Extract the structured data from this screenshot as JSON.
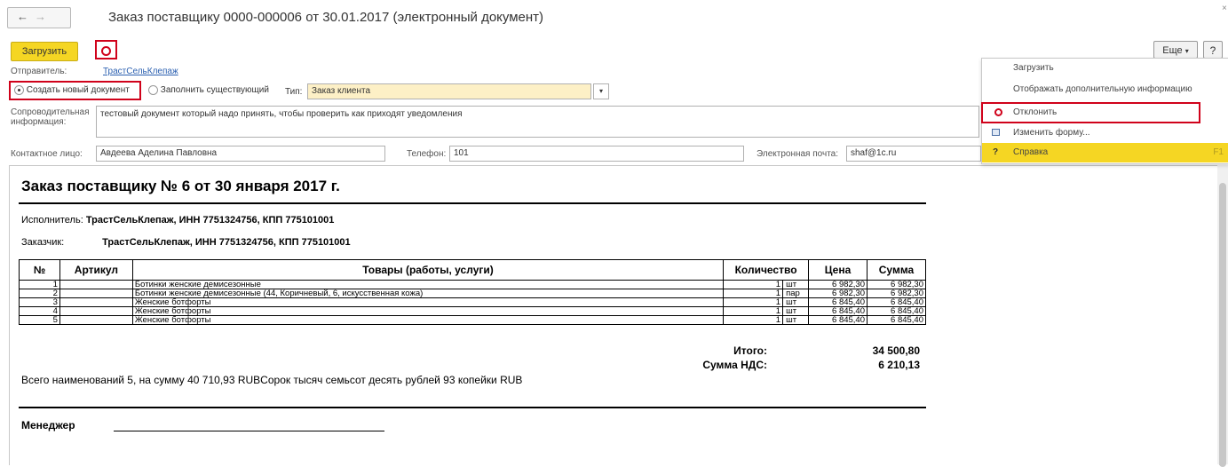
{
  "window": {
    "title": "Заказ поставщику 0000-000006 от 30.01.2017 (электронный документ)",
    "back_icon": "←",
    "forward_icon": "→"
  },
  "toolbar": {
    "load_label": "Загрузить",
    "more_label": "Еще",
    "help_label": "?"
  },
  "form": {
    "sender_label": "Отправитель:",
    "sender_value": "ТрастСельКлепаж",
    "create_new_label": "Создать новый документ",
    "fill_existing_label": "Заполнить существующий",
    "type_label": "Тип:",
    "type_value": "Заказ клиента",
    "info_label_1": "Сопроводительная",
    "info_label_2": "информация:",
    "info_value": "тестовый документ который надо принять, чтобы проверить как приходят уведомления",
    "contact_label": "Контактное лицо:",
    "contact_value": "Авдеева Аделина Павловна",
    "phone_label": "Телефон:",
    "phone_value": "101",
    "email_label": "Электронная почта:",
    "email_value": "shaf@1c.ru"
  },
  "menu": {
    "items": [
      {
        "label": "Загрузить",
        "icon": ""
      },
      {
        "label": "Отображать дополнительную информацию",
        "icon": ""
      },
      {
        "label": "Отклонить",
        "icon": "reject-icon"
      },
      {
        "label": "Изменить форму...",
        "icon": "form-settings-icon"
      },
      {
        "label": "Справка",
        "icon": "help-icon",
        "shortcut": "F1"
      }
    ],
    "colors": {
      "highlight": "#f5d623",
      "reject_border": "#d0021b"
    }
  },
  "document": {
    "heading": "Заказ поставщику № 6 от 30 января 2017 г.",
    "executor_label": "Исполнитель:",
    "executor_value": "ТрастСельКлепаж, ИНН 7751324756, КПП 775101001",
    "customer_label": "Заказчик:",
    "customer_value": "ТрастСельКлепаж, ИНН 7751324756, КПП 775101001",
    "table": {
      "headers": [
        "№",
        "Артикул",
        "Товары (работы, услуги)",
        "Количество",
        "Цена",
        "Сумма"
      ],
      "rows": [
        {
          "n": "1",
          "art": "",
          "name": "Ботинки женские демисезонные",
          "qty": "1",
          "unit": "шт",
          "price": "6 982,30",
          "sum": "6 982,30"
        },
        {
          "n": "2",
          "art": "",
          "name": "Ботинки женские демисезонные (44, Коричневый, 6, искусственная кожа)",
          "qty": "1",
          "unit": "пар",
          "price": "6 982,30",
          "sum": "6 982,30"
        },
        {
          "n": "3",
          "art": "",
          "name": "Женские ботфорты",
          "qty": "1",
          "unit": "шт",
          "price": "6 845,40",
          "sum": "6 845,40"
        },
        {
          "n": "4",
          "art": "",
          "name": "Женские ботфорты",
          "qty": "1",
          "unit": "шт",
          "price": "6 845,40",
          "sum": "6 845,40"
        },
        {
          "n": "5",
          "art": "",
          "name": "Женские ботфорты",
          "qty": "1",
          "unit": "шт",
          "price": "6 845,40",
          "sum": "6 845,40"
        }
      ]
    },
    "total_label": "Итого:",
    "total_value": "34 500,80",
    "vat_label": "Сумма НДС:",
    "vat_value": "6 210,13",
    "summary": "Всего наименований 5, на сумму 40 710,93 RUBСорок тысяч семьсот десять рублей 93 копейки RUB",
    "manager_label": "Менеджер"
  }
}
